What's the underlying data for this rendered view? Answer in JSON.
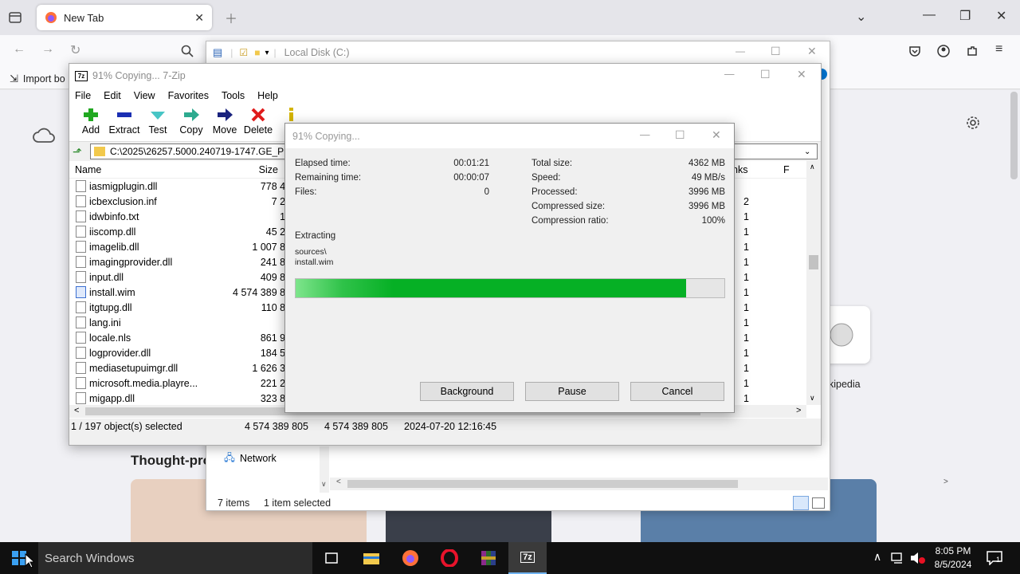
{
  "firefox": {
    "tab_title": "New Tab",
    "bookmarks_item": "Import bo",
    "thoughts_heading": "Thought-pro",
    "shortcut_label": "kipedia"
  },
  "explorer": {
    "path": "Local Disk (C:)",
    "nav_network": "Network",
    "status_items": "7 items",
    "status_selected": "1 item selected",
    "links_col": "nks",
    "f_col": "F",
    "links_values": [
      "2",
      "1",
      "1",
      "1",
      "1",
      "1",
      "1",
      "1",
      "1",
      "1",
      "1",
      "1",
      "1",
      "1",
      "1"
    ]
  },
  "zip": {
    "title": "91% Copying... 7-Zip",
    "menu": [
      "File",
      "Edit",
      "View",
      "Favorites",
      "Tools",
      "Help"
    ],
    "toolbar": [
      "Add",
      "Extract",
      "Test",
      "Copy",
      "Move",
      "Delete",
      "In"
    ],
    "path": "C:\\2025\\26257.5000.240719-1747.GE_PRE",
    "col_name": "Name",
    "col_size": "Size",
    "files": [
      {
        "name": "iasmigplugin.dll",
        "size": "778 464"
      },
      {
        "name": "icbexclusion.inf",
        "size": "7 222"
      },
      {
        "name": "idwbinfo.txt",
        "size": "125"
      },
      {
        "name": "iiscomp.dll",
        "size": "45 280"
      },
      {
        "name": "imagelib.dll",
        "size": "1 007 840"
      },
      {
        "name": "imagingprovider.dll",
        "size": "241 888"
      },
      {
        "name": "input.dll",
        "size": "409 824"
      },
      {
        "name": "install.wim",
        "size": "4 574 389 805"
      },
      {
        "name": "itgtupg.dll",
        "size": "110 816"
      },
      {
        "name": "lang.ini",
        "size": "78"
      },
      {
        "name": "locale.nls",
        "size": "861 992"
      },
      {
        "name": "logprovider.dll",
        "size": "184 544"
      },
      {
        "name": "mediasetupuimgr.dll",
        "size": "1 626 336"
      },
      {
        "name": "microsoft.media.playre...",
        "size": "221 248"
      },
      {
        "name": "migapp.dll",
        "size": "323 808"
      }
    ],
    "status": {
      "selected": "1 / 197 object(s) selected",
      "size1": "4 574 389 805",
      "size2": "4 574 389 805",
      "date": "2024-07-20 12:16:45"
    }
  },
  "dialog": {
    "title": "91% Copying...",
    "left": [
      {
        "label": "Elapsed time:",
        "value": "00:01:21"
      },
      {
        "label": "Remaining time:",
        "value": "00:00:07"
      },
      {
        "label": "Files:",
        "value": "0"
      }
    ],
    "right": [
      {
        "label": "Total size:",
        "value": "4362 MB"
      },
      {
        "label": "Speed:",
        "value": "49 MB/s"
      },
      {
        "label": "Processed:",
        "value": "3996 MB"
      },
      {
        "label": "Compressed size:",
        "value": "3996 MB"
      },
      {
        "label": "Compression ratio:",
        "value": "100%"
      }
    ],
    "action": "Extracting",
    "file_line1": "sources\\",
    "file_line2": "install.wim",
    "progress": 0.91,
    "buttons": {
      "background": "Background",
      "pause": "Pause",
      "cancel": "Cancel"
    }
  },
  "taskbar": {
    "search_placeholder": "Search Windows",
    "time": "8:05 PM",
    "date": "8/5/2024",
    "notification_count": "1"
  },
  "colors": {
    "progress_green": "#06b025",
    "taskbar": "#101010",
    "accent_blue": "#0078d7"
  }
}
